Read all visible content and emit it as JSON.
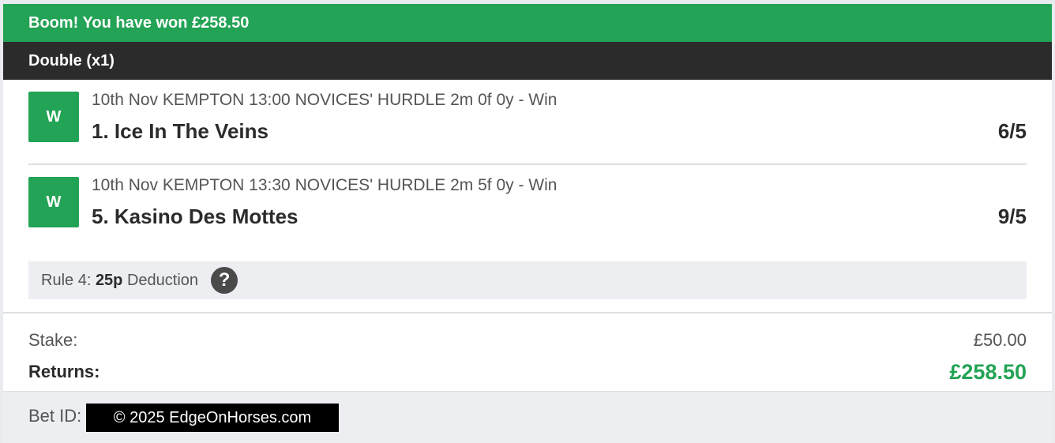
{
  "banner": {
    "message": "Boom! You have won £258.50"
  },
  "bet": {
    "type": "Double (x1)"
  },
  "selections": [
    {
      "result": "W",
      "race": "10th Nov KEMPTON 13:00 NOVICES' HURDLE 2m 0f 0y - Win",
      "runner": "1. Ice In The Veins",
      "odds": "6/5"
    },
    {
      "result": "W",
      "race": "10th Nov KEMPTON 13:30 NOVICES' HURDLE 2m 5f 0y - Win",
      "runner": "5. Kasino Des Mottes",
      "odds": "9/5"
    }
  ],
  "rule4": {
    "prefix": "Rule 4: ",
    "amount": "25p",
    "suffix": " Deduction",
    "help_icon": "question-mark-icon",
    "help_glyph": "?"
  },
  "totals": {
    "stake_label": "Stake:",
    "stake_value": "£50.00",
    "returns_label": "Returns:",
    "returns_value": "£258.50"
  },
  "footer": {
    "bet_id_label": "Bet ID:",
    "watermark": "© 2025 EdgeOnHorses.com"
  },
  "colors": {
    "win_green": "#22a355",
    "dark_bar": "#2b2b2b",
    "panel_grey": "#eceef1"
  }
}
